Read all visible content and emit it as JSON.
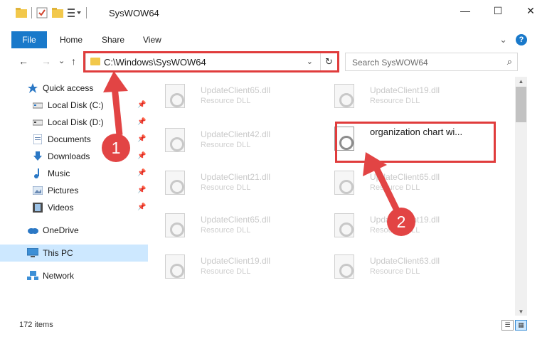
{
  "window": {
    "title": "SysWOW64",
    "minimize": "—",
    "maximize": "☐",
    "close": "✕"
  },
  "ribbon": {
    "tabs": [
      "File",
      "Home",
      "Share",
      "View"
    ],
    "expand": "⌄",
    "help": "?"
  },
  "nav": {
    "back": "←",
    "forward": "→",
    "recent": "⌄",
    "up": "↑"
  },
  "address": {
    "path": "C:\\Windows\\SysWOW64",
    "dropdown": "⌄",
    "refresh": "↻"
  },
  "search": {
    "placeholder": "Search SysWOW64",
    "icon": "⌕"
  },
  "sidebar": {
    "items": [
      {
        "label": "Quick access",
        "icon": "star-icon"
      },
      {
        "label": "Local Disk (C:)",
        "icon": "drive-icon",
        "pinned": true
      },
      {
        "label": "Local Disk (D:)",
        "icon": "drive-icon",
        "pinned": true
      },
      {
        "label": "Documents",
        "icon": "documents-icon",
        "pinned": true
      },
      {
        "label": "Downloads",
        "icon": "downloads-icon",
        "pinned": true
      },
      {
        "label": "Music",
        "icon": "music-icon",
        "pinned": true
      },
      {
        "label": "Pictures",
        "icon": "pictures-icon",
        "pinned": true
      },
      {
        "label": "Videos",
        "icon": "videos-icon",
        "pinned": true
      },
      {
        "label": "OneDrive",
        "icon": "cloud-icon"
      },
      {
        "label": "This PC",
        "icon": "computer-icon",
        "selected": true
      },
      {
        "label": "Network",
        "icon": "network-icon"
      }
    ]
  },
  "files": [
    {
      "name": "UpdateClient65.dll",
      "type": "Resource DLL"
    },
    {
      "name": "UpdateClient19.dll",
      "type": "Resource DLL"
    },
    {
      "name": "UpdateClient42.dll",
      "type": "Resource DLL"
    },
    {
      "name": "organization chart wi...",
      "type": "",
      "selected": true
    },
    {
      "name": "UpdateClient21.dll",
      "type": "Resource DLL"
    },
    {
      "name": "UpdateClient65.dll",
      "type": "Resource DLL"
    },
    {
      "name": "UpdateClient65.dll",
      "type": "Resource DLL"
    },
    {
      "name": "UpdateClient19.dll",
      "type": "Resource DLL"
    },
    {
      "name": "UpdateClient19.dll",
      "type": "Resource DLL"
    },
    {
      "name": "UpdateClient63.dll",
      "type": "Resource DLL"
    }
  ],
  "status": {
    "item_count": "172 items"
  },
  "annotations": {
    "step1": "1",
    "step2": "2",
    "color": "#e24444"
  }
}
